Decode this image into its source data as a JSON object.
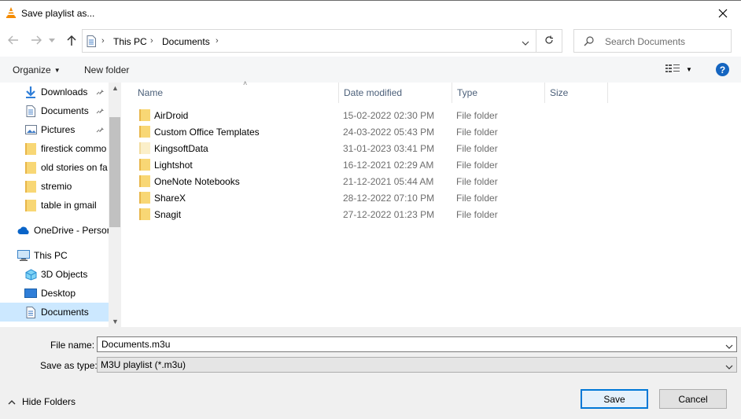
{
  "window": {
    "title": "Save playlist as..."
  },
  "address": {
    "crumbs": [
      "This PC",
      "Documents"
    ],
    "search_placeholder": "Search Documents"
  },
  "toolbar": {
    "organize_label": "Organize",
    "new_folder_label": "New folder",
    "help_label": "?"
  },
  "nav": {
    "items": [
      {
        "label": "Downloads",
        "icon": "download-icon",
        "pinned": true
      },
      {
        "label": "Documents",
        "icon": "document-icon",
        "pinned": true
      },
      {
        "label": "Pictures",
        "icon": "pictures-icon",
        "pinned": true
      },
      {
        "label": "firestick commo",
        "icon": "folder-icon",
        "pinned": false
      },
      {
        "label": "old stories on fa",
        "icon": "folder-icon",
        "pinned": false
      },
      {
        "label": "stremio",
        "icon": "folder-icon",
        "pinned": false
      },
      {
        "label": "table in gmail",
        "icon": "folder-icon",
        "pinned": false
      },
      {
        "label": "OneDrive - Persor",
        "icon": "onedrive-icon",
        "pinned": false
      },
      {
        "label": "This PC",
        "icon": "pc-icon",
        "pinned": false
      },
      {
        "label": "3D Objects",
        "icon": "3d-objects-icon",
        "pinned": false
      },
      {
        "label": "Desktop",
        "icon": "desktop-icon",
        "pinned": false
      },
      {
        "label": "Documents",
        "icon": "document-icon",
        "pinned": false,
        "selected": true
      }
    ]
  },
  "columns": {
    "name": "Name",
    "date": "Date modified",
    "type": "Type",
    "size": "Size"
  },
  "files": [
    {
      "name": "AirDroid",
      "date": "15-02-2022 02:30 PM",
      "type": "File folder",
      "icon": "folder-icon"
    },
    {
      "name": "Custom Office Templates",
      "date": "24-03-2022 05:43 PM",
      "type": "File folder",
      "icon": "folder-icon"
    },
    {
      "name": "KingsoftData",
      "date": "31-01-2023 03:41 PM",
      "type": "File folder",
      "icon": "folder-faded-icon"
    },
    {
      "name": "Lightshot",
      "date": "16-12-2021 02:29 AM",
      "type": "File folder",
      "icon": "folder-icon"
    },
    {
      "name": "OneNote Notebooks",
      "date": "21-12-2021 05:44 AM",
      "type": "File folder",
      "icon": "folder-icon"
    },
    {
      "name": "ShareX",
      "date": "28-12-2022 07:10 PM",
      "type": "File folder",
      "icon": "folder-icon"
    },
    {
      "name": "Snagit",
      "date": "27-12-2022 01:23 PM",
      "type": "File folder",
      "icon": "folder-icon"
    }
  ],
  "form": {
    "filename_label": "File name:",
    "filename_value": "Documents.m3u",
    "savetype_label": "Save as type:",
    "savetype_value": "M3U playlist (*.m3u)"
  },
  "footer": {
    "hide_folders_label": "Hide Folders",
    "save_label": "Save",
    "cancel_label": "Cancel"
  },
  "colors": {
    "folder": "#f2c55c",
    "selection": "#cce8ff",
    "accent": "#0078d7",
    "help": "#1565c0"
  }
}
